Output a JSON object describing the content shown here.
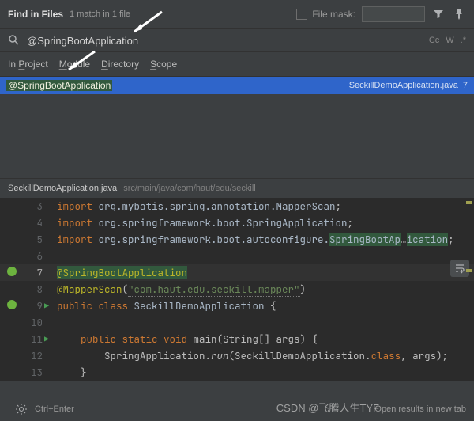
{
  "header": {
    "title": "Find in Files",
    "sub": "1 match in 1 file",
    "mask_label": "File mask:"
  },
  "search": {
    "query": "@SpringBootApplication",
    "cc": "Cc",
    "w": "W",
    "regex": ".*"
  },
  "scope": {
    "in_project": "In Project",
    "module": "Module",
    "directory": "Directory",
    "scope": "Scope"
  },
  "results": {
    "match": "@SpringBootApplication",
    "file": "SeckillDemoApplication.java",
    "line": "7"
  },
  "preview": {
    "file": "SeckillDemoApplication.java",
    "path": "src/main/java/com/haut/edu/seckill"
  },
  "code": {
    "l3": {
      "num": "3",
      "kw": "import",
      "pkg": " org.mybatis.spring.annotation.",
      "cls": "MapperScan",
      "semi": ";"
    },
    "l4": {
      "num": "4",
      "kw": "import",
      "pkg": " org.springframework.boot.",
      "cls": "SpringApplication",
      "semi": ";"
    },
    "l5": {
      "num": "5",
      "kw": "import",
      "pkg": " org.springframework.boot.autoconfigure.",
      "cls": "SpringBootAp",
      "tail": "ication",
      "semi": ";"
    },
    "l6": {
      "num": "6"
    },
    "l7": {
      "num": "7",
      "ann": "@SpringBootApplication"
    },
    "l8": {
      "num": "8",
      "ann": "@MapperScan",
      "paren": "(",
      "str": "\"com.haut.edu.seckill.mapper\"",
      "paren2": ")"
    },
    "l9": {
      "num": "9",
      "kw": "public class ",
      "cls": "SeckillDemoApplication",
      "brace": " {"
    },
    "l10": {
      "num": "10"
    },
    "l11": {
      "num": "11",
      "indent": "    ",
      "kw": "public static void ",
      "m": "main",
      "args": "(String[] args) {"
    },
    "l12": {
      "num": "12",
      "indent": "        ",
      "call": "SpringApplication.",
      "m": "run",
      "args": "(SeckillDemoApplication.",
      "kw": "class",
      "tail": ", args);"
    },
    "l13": {
      "num": "13",
      "indent": "    ",
      "brace": "}"
    }
  },
  "footer": {
    "hint": "Ctrl+Enter",
    "tool": "Open results in new tab"
  },
  "watermark": "CSDN @飞腾人生TYF"
}
